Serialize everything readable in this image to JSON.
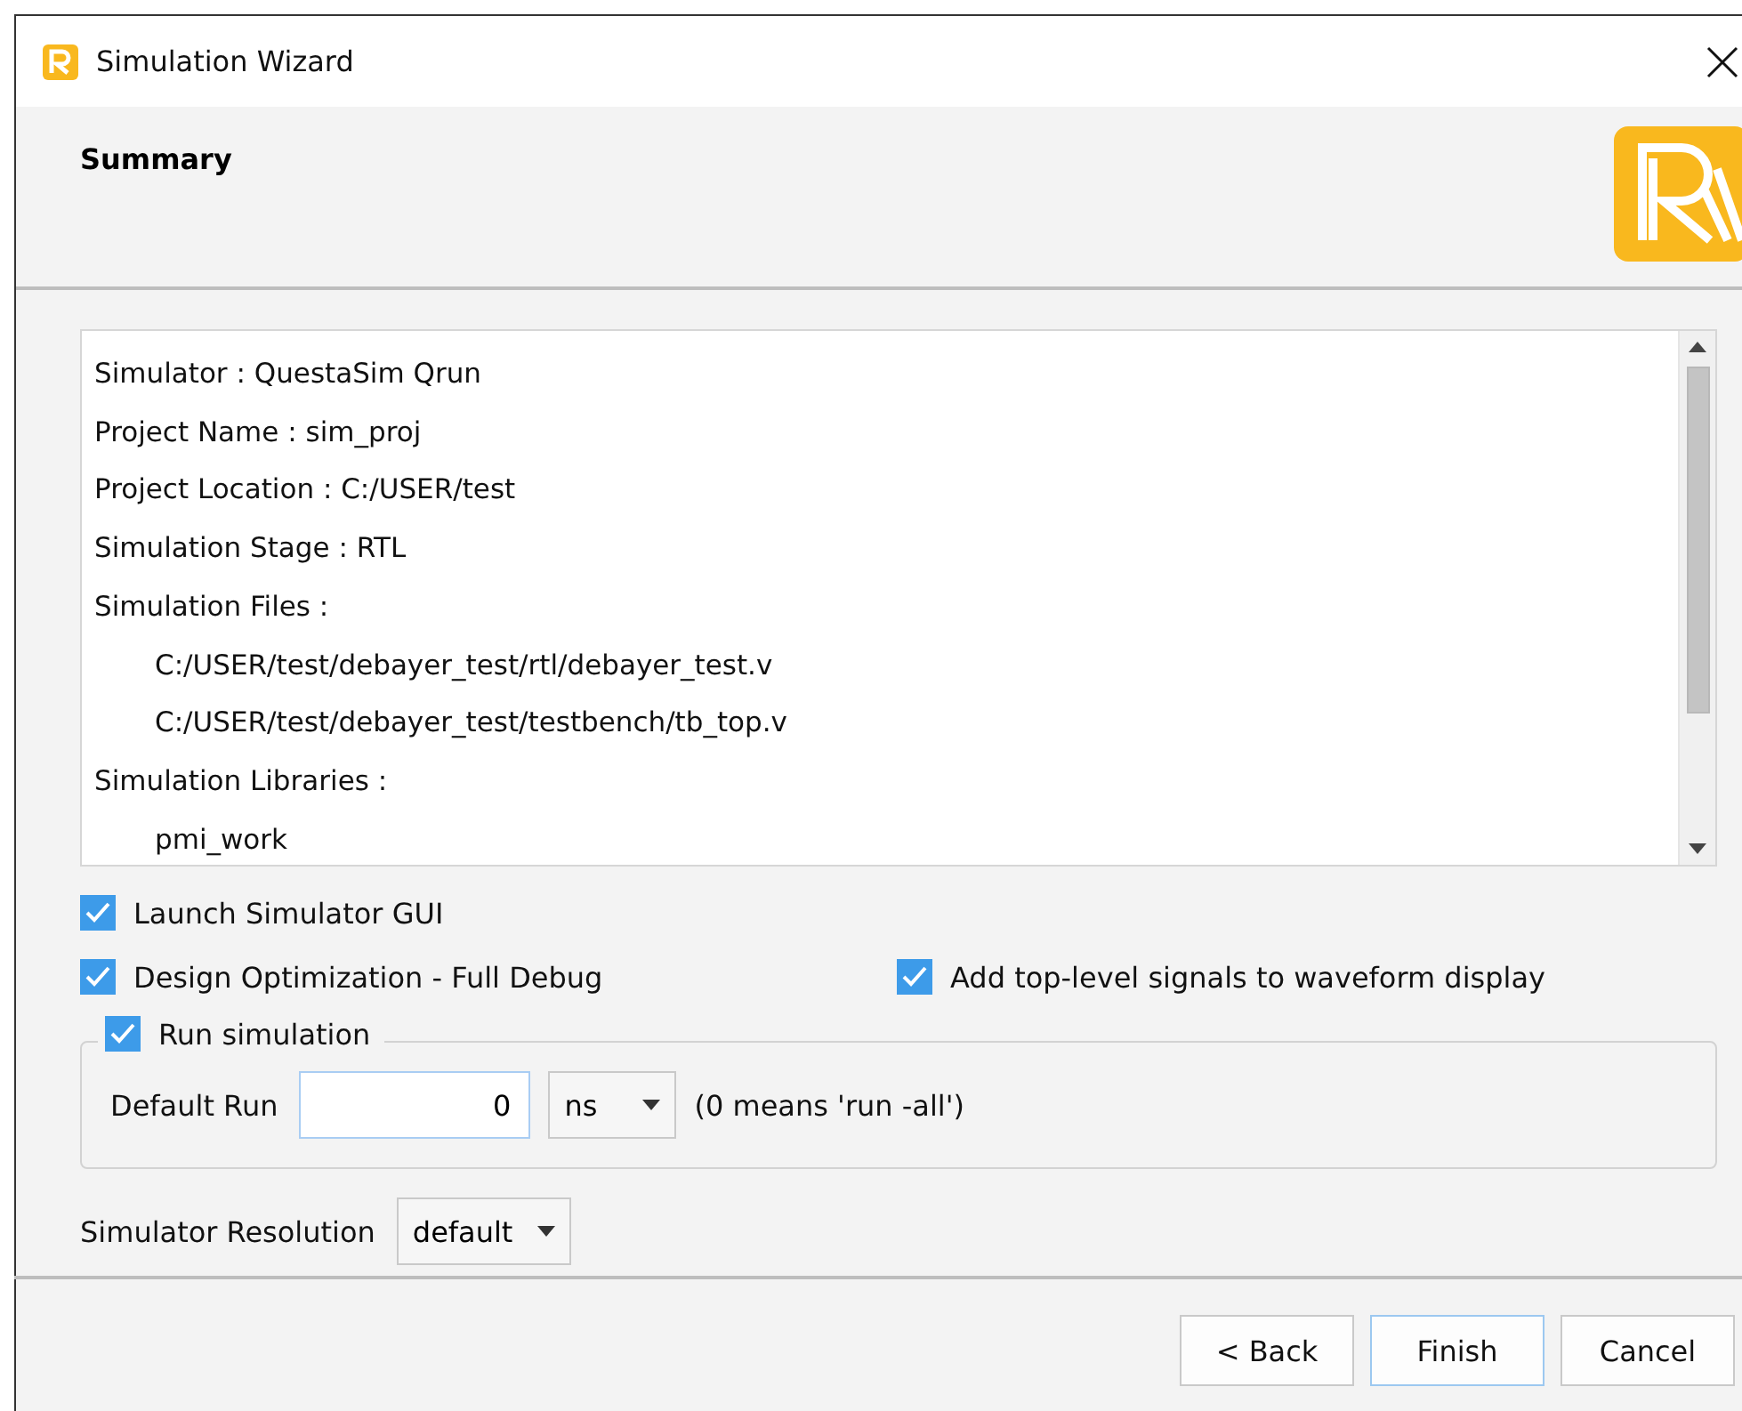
{
  "window": {
    "title": "Simulation Wizard"
  },
  "header": {
    "title": "Summary"
  },
  "summary": [
    {
      "text": "Simulator : QuestaSim Qrun"
    },
    {
      "text": "Project Name : sim_proj"
    },
    {
      "text": "Project Location : C:/USER/test"
    },
    {
      "text": "Simulation Stage : RTL"
    },
    {
      "text": "Simulation Files :",
      "children": [
        {
          "text": "C:/USER/test/debayer_test/rtl/debayer_test.v"
        },
        {
          "text": "C:/USER/test/debayer_test/testbench/tb_top.v"
        }
      ]
    },
    {
      "text": "Simulation Libraries :",
      "children": [
        {
          "text": "pmi_work"
        }
      ]
    }
  ],
  "options": [
    {
      "label": "Launch Simulator GUI",
      "checked": true
    },
    {
      "label": "Design Optimization - Full Debug",
      "checked": true
    },
    {
      "label": "Add top-level signals to waveform display",
      "checked": true
    }
  ],
  "run_simulation": {
    "label": "Run simulation",
    "checked": true,
    "default_run_label": "Default Run",
    "value": "0",
    "unit": "ns",
    "hint": "(0 means 'run -all')"
  },
  "resolution": {
    "label": "Simulator Resolution",
    "value": "default"
  },
  "buttons": [
    {
      "label": "< Back",
      "selected": false
    },
    {
      "label": "Finish",
      "selected": true
    },
    {
      "label": "Cancel",
      "selected": false
    }
  ]
}
